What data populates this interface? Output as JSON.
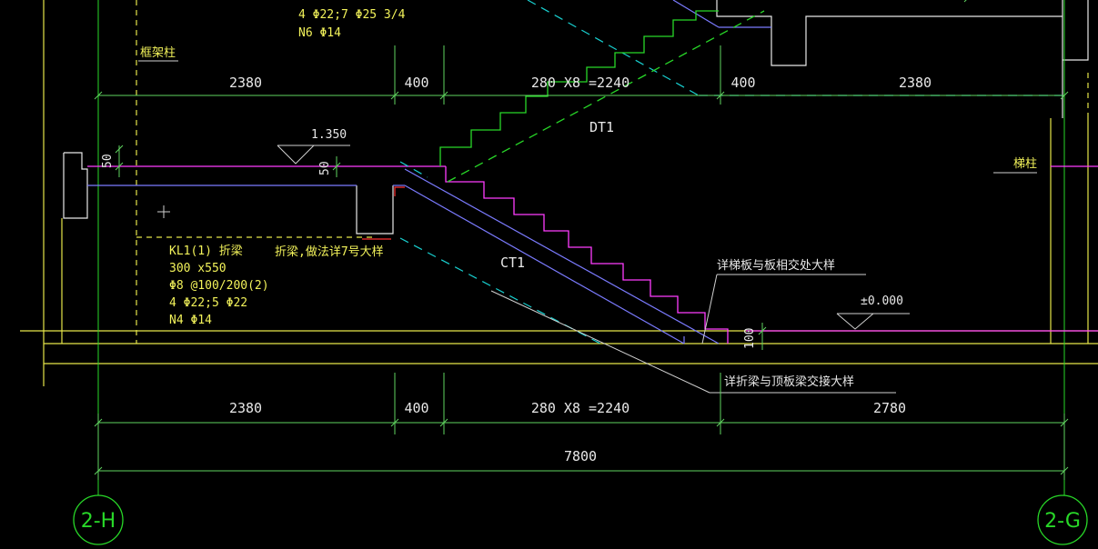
{
  "colors": {
    "background": "#000000",
    "dimension": "#5fd35f",
    "text_white": "#e8e8e8",
    "text_yellow": "#f2f25a",
    "magenta": "#ff3cff",
    "blue": "#7b7bff",
    "cyan": "#18d0d0",
    "green": "#28d828",
    "red": "#ff3030"
  },
  "top_dims": {
    "d1": "2380",
    "d2": "400",
    "d3": "280 X8 =2240",
    "d4": "400",
    "d5": "2380"
  },
  "bottom_dims": {
    "d1": "2380",
    "d2": "400",
    "d3": "280 X8 =2240",
    "d4": "2780",
    "total": "7800"
  },
  "top_rebar": {
    "line1": "4 Φ22;7 Φ25  3/4",
    "line2": "N6 Φ14"
  },
  "labels": {
    "frame_column": "框架柱",
    "stair_column": "梯柱",
    "dt1": "DT1",
    "ct1": "CT1",
    "elev_upper": "1.350",
    "elev_ground": "±0.000",
    "thk_50a": "50",
    "thk_50b": "50",
    "thk_100": "100",
    "folded_beam_note": "折梁,做法详7号大样",
    "detail_slab": "详梯板与板相交处大样",
    "detail_beam": "详折梁与顶板梁交接大样"
  },
  "beam_kl1": {
    "line1": "KL1(1) 折梁",
    "line2": "300 x550",
    "line3": "Φ8 @100/200(2)",
    "line4": "4 Φ22;5 Φ22",
    "line5": "N4 Φ14"
  },
  "axes": {
    "left": "2-H",
    "right": "2-G"
  }
}
